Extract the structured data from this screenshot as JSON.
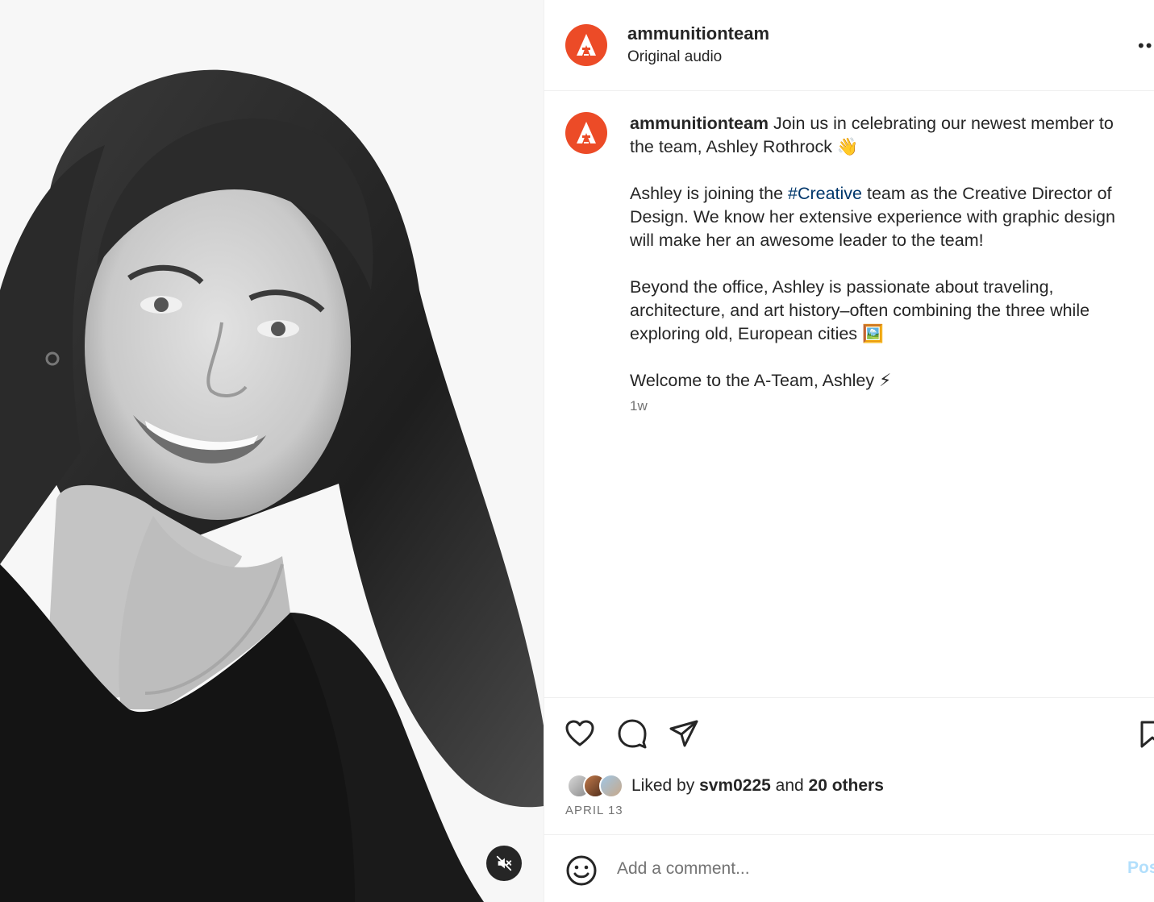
{
  "post": {
    "username": "ammunitionteam",
    "audio_label": "Original audio",
    "more_label": "••",
    "avatar_letter": "A",
    "brand_color": "#ec4b27"
  },
  "caption": {
    "username": "ammunitionteam",
    "intro": " Join us in celebrating our newest member to the team, Ashley Rothrock 👋",
    "p2_before": "Ashley is joining the ",
    "p2_hashtag": "#Creative",
    "p2_after": " team as the Creative Director of Design. We know her extensive experience with graphic design will make her an awesome leader to the team!",
    "p3": "Beyond the office, Ashley is passionate about traveling, architecture, and art history–often combining the three while exploring old, European cities 🖼️",
    "p4": "Welcome to the A-Team, Ashley ⚡",
    "time_ago": "1w"
  },
  "actions": {
    "icons": [
      "heart-icon",
      "comment-icon",
      "share-icon",
      "bookmark-icon"
    ],
    "liked_by_prefix": "Liked by ",
    "liked_by_user": "svm0225",
    "liked_by_and": " and ",
    "liked_by_others": "20 others",
    "date": "APRIL 13"
  },
  "comment": {
    "placeholder": "Add a comment...",
    "post_label": "Post"
  },
  "media": {
    "mute_icon": "speaker-muted-icon"
  }
}
